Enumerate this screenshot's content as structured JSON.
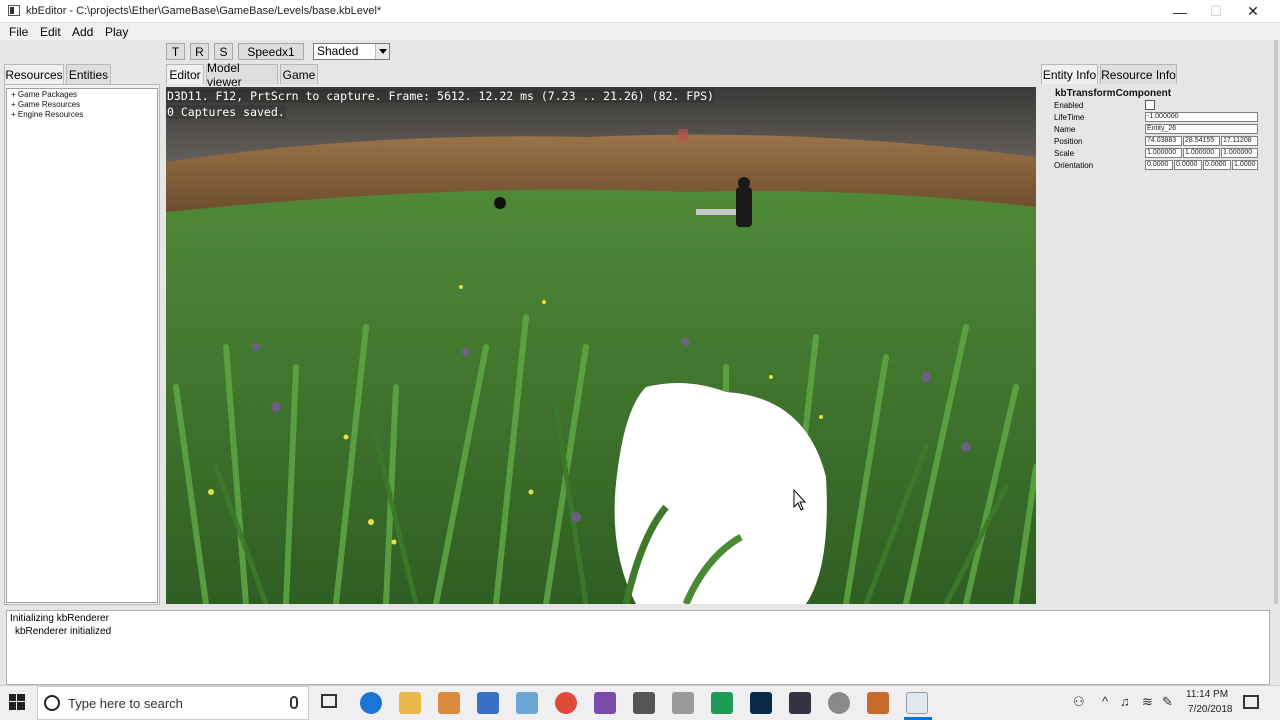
{
  "window": {
    "title": "kbEditor - C:\\projects\\Ether\\GameBase\\GameBase/Levels/base.kbLevel*",
    "minimize": "—",
    "maximize": "☐",
    "close": "✕"
  },
  "menu": [
    "File",
    "Edit",
    "Add",
    "Play"
  ],
  "toolbar": {
    "t_label": "T",
    "r_label": "R",
    "s_label": "S",
    "speed_label": "Speedx1",
    "render_mode": "Shaded"
  },
  "left_tabs": [
    "Resources",
    "Entities"
  ],
  "resource_tree": [
    "+ Game Packages",
    "+ Game Resources",
    "+ Engine Resources"
  ],
  "center_tabs": [
    "Editor",
    "Model viewer",
    "Game"
  ],
  "viewport": {
    "hud_line1": "D3D11. F12, PrtScrn to capture. Frame: 5612. 12.22 ms (7.23 .. 21.26) (82. FPS)",
    "hud_line2": "0 Captures saved."
  },
  "right_tabs": [
    "Entity Info",
    "Resource Info"
  ],
  "entity": {
    "component": "kbTransformComponent",
    "labels": {
      "enabled": "Enabled",
      "lifetime": "LifeTime",
      "name": "Name",
      "position": "Position",
      "scale": "Scale",
      "orientation": "Orientation"
    },
    "lifetime": "-1.000000",
    "name": "Entity_26",
    "position": [
      "74.03883",
      "28.54155",
      "17.11208"
    ],
    "scale": [
      "1.000000",
      "1.000000",
      "1.000000"
    ],
    "orientation": [
      "0.0000",
      "0.0000",
      "0.0000",
      "1.0000"
    ]
  },
  "log": [
    "Initializing kbRenderer",
    "kbRenderer initialized"
  ],
  "taskbar": {
    "search_placeholder": "Type here to search",
    "time": "11:14 PM",
    "date": "7/20/2018",
    "accent": "#0078d7"
  }
}
